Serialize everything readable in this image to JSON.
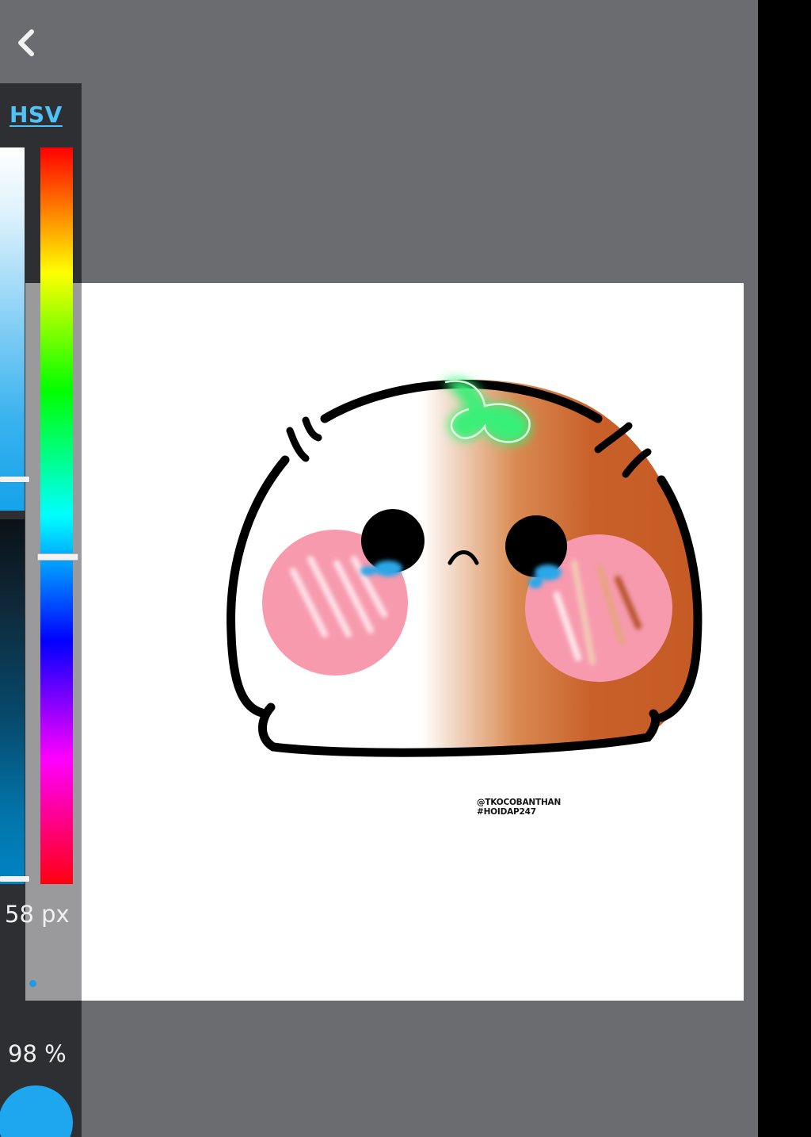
{
  "toolbar": {
    "back_icon": "chevron-left-icon"
  },
  "color_panel": {
    "mode_tab_label": "HSV",
    "hue_handle_fraction": 0.55,
    "saturation_handle_fraction": 0.91,
    "value_handle_fraction": 0.99,
    "brush_size_label": "58 px",
    "opacity_label": "98 %",
    "current_color": "#1ea6ef"
  },
  "canvas": {
    "watermark_line1": "@TKOCOBANTHAN",
    "watermark_line2": "#HOIDAP247"
  },
  "colors": {
    "workspace_bg": "#6b6c70",
    "panel_bg": "#2e2f33",
    "accent": "#4fc3f7"
  }
}
